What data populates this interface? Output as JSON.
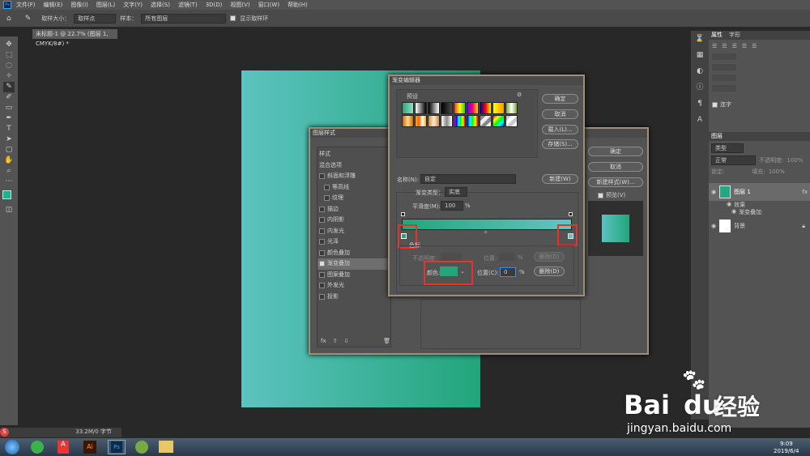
{
  "menu": {
    "app_icon": "Ps",
    "items": [
      "文件(F)",
      "编辑(E)",
      "图像(I)",
      "图层(L)",
      "文字(Y)",
      "选择(S)",
      "滤镜(T)",
      "3D(D)",
      "视图(V)",
      "窗口(W)",
      "帮助(H)"
    ]
  },
  "options": {
    "size_label": "取样大小：",
    "size_value": "取样点",
    "sample_label": "样本：",
    "sample_value": "所有图层",
    "ring_label": "显示取样环"
  },
  "doc": {
    "tab_title": "未标题-1 @ 22.7% (图层 1, CMYK/8#) *"
  },
  "status": {
    "text": "33.2M/0 字节"
  },
  "canvas": {
    "colors": [
      "#5cc3c0",
      "#22a57a"
    ]
  },
  "layer_style": {
    "title": "图层样式",
    "items": [
      "样式",
      "混合选项",
      "斜面和浮雕",
      "等高线",
      "纹理",
      "描边",
      "内阴影",
      "内发光",
      "光泽",
      "颜色叠加",
      "渐变叠加",
      "图案叠加",
      "外发光",
      "投影"
    ],
    "checkbox": [
      false,
      false,
      true,
      true,
      true,
      true,
      true,
      true,
      true,
      true,
      true,
      true,
      true,
      true
    ],
    "checked": [
      false,
      false,
      false,
      false,
      false,
      false,
      false,
      false,
      false,
      false,
      true,
      false,
      false,
      false
    ],
    "indent": [
      false,
      false,
      false,
      true,
      true,
      false,
      false,
      false,
      false,
      false,
      false,
      false,
      false,
      false
    ],
    "fx": "fx",
    "buttons": {
      "ok": "确定",
      "cancel": "取消",
      "new_style": "新建样式(W)...",
      "preview": "预览(V)"
    }
  },
  "gradient_editor": {
    "title": "渐变编辑器",
    "presets_label": "预设",
    "ok": "确定",
    "cancel": "取消",
    "load": "载入(L)...",
    "save": "存储(S)...",
    "name_label": "名称(N):",
    "name_value": "自定",
    "new_button": "新建(W)",
    "type_label": "渐变类型：",
    "type_value": "实底",
    "smooth_label": "平滑度(M):",
    "smooth_value": "100",
    "percent": "%",
    "stops_label": "色标",
    "opacity_label": "不透明度:",
    "location_label": "位置:",
    "delete": "删除(D)",
    "color_label": "颜色:",
    "location_c_label": "位置(C):",
    "location_value": "0",
    "gradient_colors": [
      "#23a67a",
      "#63c5c1"
    ]
  },
  "panels": {
    "tabs1": [
      "属性",
      "字形"
    ],
    "tabs2": [
      "图层"
    ],
    "layer_kind": "类型",
    "blend": "正常",
    "opacity_label": "不透明度:",
    "opacity": "100%",
    "lock_label": "锁定:",
    "fill_label": "填充:",
    "fill": "100%",
    "layers": [
      {
        "name": "图层 1",
        "fx": "fx"
      },
      {
        "name": "效果"
      },
      {
        "name": "渐变叠加"
      },
      {
        "name": "背景"
      }
    ],
    "char_label": "连字"
  },
  "taskbar": {
    "time": "9:09",
    "date": "2019/6/4"
  },
  "watermark": {
    "logo": "Bai",
    "logo2": "du",
    "brand": "经验",
    "url": "jingyan.baidu.com"
  }
}
